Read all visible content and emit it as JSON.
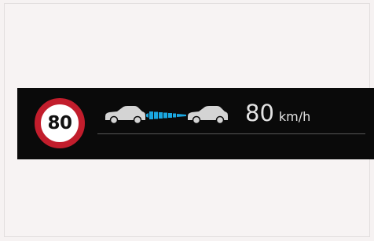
{
  "speed_limit_sign": {
    "value": "80",
    "ring_color": "#c21d2c",
    "icon": "speed-limit-sign-icon"
  },
  "distance_control": {
    "rear_vehicle_icon": "car-side-icon",
    "lead_vehicle_icon": "car-side-icon",
    "gap_icon": "following-distance-icon",
    "gap_color": "#1aa7e0",
    "car_color": "#d4d4d4"
  },
  "set_speed": {
    "value": "80",
    "unit": "km/h"
  },
  "colors": {
    "panel_background": "#0a0a0a",
    "page_background": "#f6f2f2",
    "text": "#e3e3e3"
  }
}
